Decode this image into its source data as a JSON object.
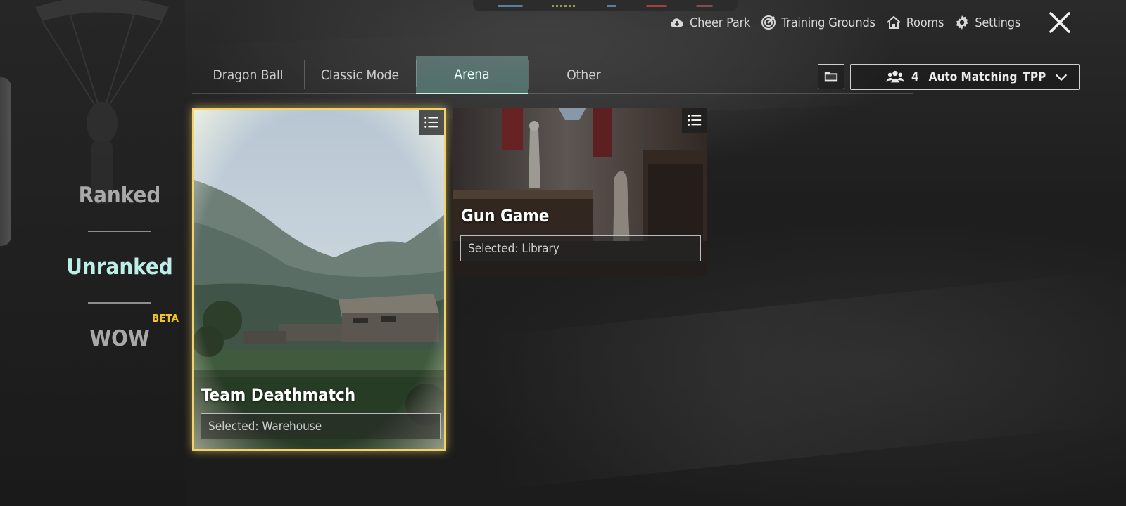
{
  "topbar": {
    "nav": [
      {
        "label": "Cheer Park",
        "icon": "cloud-icon"
      },
      {
        "label": "Training Grounds",
        "icon": "target-icon"
      },
      {
        "label": "Rooms",
        "icon": "home-icon"
      },
      {
        "label": "Settings",
        "icon": "gear-icon"
      }
    ],
    "close_icon": "close-icon"
  },
  "tabs": [
    {
      "label": "Dragon Ball",
      "active": false
    },
    {
      "label": "Classic Mode",
      "active": false
    },
    {
      "label": "Arena",
      "active": true
    },
    {
      "label": "Other",
      "active": false
    }
  ],
  "matching": {
    "team_size": "4",
    "label": "Auto Matching",
    "perspective": "TPP"
  },
  "modes": [
    {
      "label": "Ranked",
      "active": false
    },
    {
      "label": "Unranked",
      "active": true
    },
    {
      "label": "WOW",
      "active": false,
      "badge": "BETA"
    }
  ],
  "cards": [
    {
      "title": "Team Deathmatch",
      "selected": "Selected: Warehouse",
      "highlighted": true
    },
    {
      "title": "Gun Game",
      "selected": "Selected: Library",
      "highlighted": false
    }
  ],
  "colors": {
    "active_tab": "#7fa8a2",
    "active_mode": "#bdeee7",
    "beta": "#f3c42a",
    "card_highlight": "#f0d36a"
  }
}
